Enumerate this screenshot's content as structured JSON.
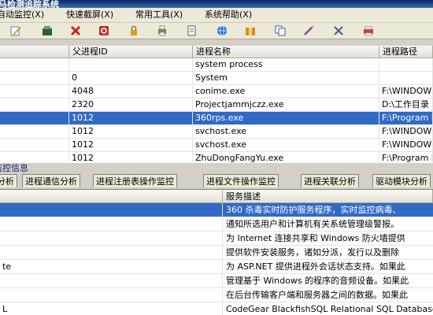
{
  "window": {
    "title": "马检测追踪系统"
  },
  "menu": [
    {
      "label": "自动监控(X)"
    },
    {
      "label": "快速截屏(X)"
    },
    {
      "label": "常用工具(X)"
    },
    {
      "label": "系统帮助(X)"
    }
  ],
  "toolbar": [
    {
      "icon": "edit-icon",
      "color": "#4a7fd6"
    },
    {
      "icon": "save-icon",
      "color": "#2e5f2e"
    },
    {
      "icon": "delete-icon",
      "color": "#d42020"
    },
    {
      "icon": "refresh-icon",
      "color": "#c03030"
    },
    {
      "icon": "lock-icon",
      "color": "#d9a020"
    },
    {
      "icon": "print-icon",
      "color": "#8a7a5a"
    },
    {
      "icon": "document-icon",
      "color": "#606060"
    },
    {
      "icon": "globe-icon",
      "color": "#2a74c8"
    },
    {
      "icon": "package-icon",
      "color": "#e08a20"
    },
    {
      "icon": "copy-icon",
      "color": "#4060a0"
    },
    {
      "icon": "pen-icon",
      "color": "#7050a0"
    },
    {
      "icon": "tools-icon",
      "color": "#2060b0"
    },
    {
      "icon": "printer-icon",
      "color": "#c04040"
    }
  ],
  "process_table": {
    "headers": [
      "父进程ID",
      "进程名称",
      "进程路径"
    ],
    "rows": [
      {
        "ppid": "",
        "name": "system process",
        "path": ""
      },
      {
        "ppid": "0",
        "name": "System",
        "path": ""
      },
      {
        "ppid": "4048",
        "name": "conime.exe",
        "path": "F:\\WINDOWS"
      },
      {
        "ppid": "2320",
        "name": "Projectjammjczz.exe",
        "path": "D:\\工作目录"
      },
      {
        "ppid": "1012",
        "name": "360rps.exe",
        "path": "F:\\Program F"
      },
      {
        "ppid": "1012",
        "name": "svchost.exe",
        "path": "F:\\WINDOWS"
      },
      {
        "ppid": "1012",
        "name": "svchost.exe",
        "path": "F:\\WINDOWS"
      },
      {
        "ppid": "1012",
        "name": "ZhuDongFangYu.exe",
        "path": "F:\\Program F"
      }
    ],
    "selected_index": 4
  },
  "panel": {
    "title": "监控信息"
  },
  "tabs": [
    "分析",
    "进程通信分析",
    "进程注册表操作监控",
    "进程文件操作监控",
    "进程关联分析",
    "驱动模块分析"
  ],
  "service_table": {
    "header": "服务描述",
    "rows": [
      {
        "name": "",
        "desc": "360 杀毒实时防护服务程序，实时监控病毒、"
      },
      {
        "name": "",
        "desc": "通知所选用户和计算机有关系统管理级警报。"
      },
      {
        "name": "",
        "desc": "为 Internet 连接共享和 Windows 防火墙提供"
      },
      {
        "name": "",
        "desc": "提供软件安装服务，诸如分派，发行以及删除"
      },
      {
        "name": "te",
        "desc": "为 ASP.NET 提供进程外会话状态支持。如果此"
      },
      {
        "name": "",
        "desc": "管理基于 Windows 的程序的音频设备。如果此"
      },
      {
        "name": "",
        "desc": "在后台传输客户端和服务器之间的数据。如果此"
      },
      {
        "name": "L",
        "desc": "CodeGear BlackfishSQL Relational SQL Database"
      }
    ],
    "selected_index": 0
  }
}
